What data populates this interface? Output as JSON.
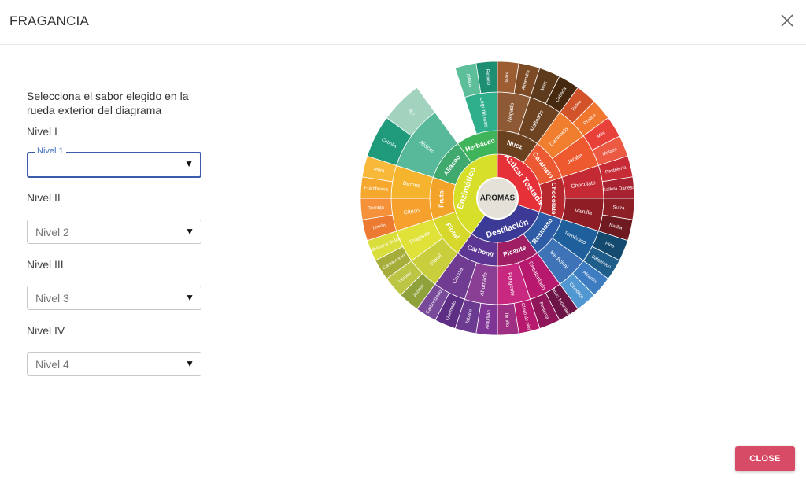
{
  "dialog": {
    "title": "FRAGANCIA",
    "close_label": "CLOSE"
  },
  "form": {
    "instructions": "Selecciona el sabor elegido en la rueda exterior del diagrama",
    "levels": [
      {
        "label": "Nivel I",
        "placeholder": "Nivel 1"
      },
      {
        "label": "Nivel II",
        "placeholder": "Nivel 2"
      },
      {
        "label": "Nivel III",
        "placeholder": "Nivel 3"
      },
      {
        "label": "Nivel IV",
        "placeholder": "Nivel 4"
      }
    ],
    "arrow": "▼"
  },
  "wheel": {
    "center": "AROMAS",
    "level1": [
      {
        "label": "Enzimático",
        "color": "#d8df2a",
        "start": 216,
        "end": 360
      },
      {
        "label": "Azúcar Tostada",
        "color": "#e63138",
        "start": 0,
        "end": 108
      },
      {
        "label": "Destilación",
        "color": "#3b3a96",
        "start": 108,
        "end": 216
      }
    ],
    "level2": [
      {
        "label": "Herbáceo",
        "color": "#40b45a",
        "start": 324,
        "end": 360
      },
      {
        "label": "Nuez",
        "color": "#6b4220",
        "start": 0,
        "end": 36
      },
      {
        "label": "Caramelo",
        "color": "#ec5a33",
        "start": 36,
        "end": 72
      },
      {
        "label": "Chocolate",
        "color": "#b7282e",
        "start": 72,
        "end": 108
      },
      {
        "label": "Resinoso",
        "color": "#2e5ca6",
        "start": 108,
        "end": 144
      },
      {
        "label": "Picante",
        "color": "#a01e63",
        "start": 144,
        "end": 180
      },
      {
        "label": "Carbonil",
        "color": "#5d3693",
        "start": 180,
        "end": 216
      },
      {
        "label": "Floral",
        "color": "#d6d92b",
        "start": 216,
        "end": 252
      },
      {
        "label": "Frutal",
        "color": "#f4a32a",
        "start": 252,
        "end": 288
      },
      {
        "label": "Aliáceo",
        "color": "#3fa96e",
        "start": 288,
        "end": 324
      }
    ],
    "level3": [
      {
        "label": "Leguminoso",
        "color": "#2fae8c",
        "start": 342,
        "end": 360
      },
      {
        "label": "Nogado",
        "color": "#8d5a35",
        "start": 0,
        "end": 18
      },
      {
        "label": "Malteado",
        "color": "#6e4322",
        "start": 18,
        "end": 36
      },
      {
        "label": "Caramelo",
        "color": "#f07e2e",
        "start": 36,
        "end": 54
      },
      {
        "label": "Jarabe",
        "color": "#ee5a30",
        "start": 54,
        "end": 72
      },
      {
        "label": "Chocolate",
        "color": "#c32a33",
        "start": 72,
        "end": 90
      },
      {
        "label": "Vainilla",
        "color": "#8e1d25",
        "start": 90,
        "end": 108
      },
      {
        "label": "Terpénico",
        "color": "#1f5f9b",
        "start": 108,
        "end": 126
      },
      {
        "label": "Medicinal",
        "color": "#3e73b8",
        "start": 126,
        "end": 144
      },
      {
        "label": "Recalentado",
        "color": "#b6196d",
        "start": 144,
        "end": 162
      },
      {
        "label": "Pungente",
        "color": "#c8287f",
        "start": 162,
        "end": 180
      },
      {
        "label": "Ahumado",
        "color": "#8b3f94",
        "start": 180,
        "end": 198
      },
      {
        "label": "Ceniza",
        "color": "#6f3c91",
        "start": 198,
        "end": 216
      },
      {
        "label": "Floral",
        "color": "#c9cf3c",
        "start": 216,
        "end": 234
      },
      {
        "label": "Fragante",
        "color": "#e0e23a",
        "start": 234,
        "end": 252
      },
      {
        "label": "Cítrico",
        "color": "#f6a12e",
        "start": 252,
        "end": 270
      },
      {
        "label": "Berries",
        "color": "#f6b42e",
        "start": 270,
        "end": 288
      },
      {
        "label": "Aliáceo",
        "color": "#57b99a",
        "start": 288,
        "end": 324
      }
    ],
    "level4": [
      {
        "label": "Alfalfa",
        "color": "#5cbf9a",
        "start": 342,
        "end": 351
      },
      {
        "label": "Repollo",
        "color": "#1d8e72",
        "start": 351,
        "end": 360
      },
      {
        "label": "Maní",
        "color": "#9b5d31",
        "start": 0,
        "end": 9
      },
      {
        "label": "Almendra",
        "color": "#7c4a24",
        "start": 9,
        "end": 18
      },
      {
        "label": "Maíz",
        "color": "#5e3a1c",
        "start": 18,
        "end": 27
      },
      {
        "label": "Cebada",
        "color": "#47290f",
        "start": 27,
        "end": 36
      },
      {
        "label": "Toffee",
        "color": "#d2522a",
        "start": 36,
        "end": 45
      },
      {
        "label": "Praline",
        "color": "#f2772e",
        "start": 45,
        "end": 54
      },
      {
        "label": "Miel",
        "color": "#e8413a",
        "start": 54,
        "end": 63
      },
      {
        "label": "Melaza",
        "color": "#ec5a44",
        "start": 63,
        "end": 72
      },
      {
        "label": "Pastelería",
        "color": "#c62b36",
        "start": 72,
        "end": 81
      },
      {
        "label": "Galleta Danesa",
        "color": "#a72230",
        "start": 81,
        "end": 90
      },
      {
        "label": "Suiza",
        "color": "#8d1f26",
        "start": 90,
        "end": 99
      },
      {
        "label": "Natilla",
        "color": "#6f1a21",
        "start": 99,
        "end": 108
      },
      {
        "label": "Pino",
        "color": "#154a6f",
        "start": 108,
        "end": 117
      },
      {
        "label": "Balsámico",
        "color": "#1f5d8a",
        "start": 117,
        "end": 126
      },
      {
        "label": "Alcanfor",
        "color": "#3d7cc0",
        "start": 126,
        "end": 135
      },
      {
        "label": "Cineólico",
        "color": "#5197d1",
        "start": 135,
        "end": 144
      },
      {
        "label": "Nuez Moscada",
        "color": "#6d1446",
        "start": 144,
        "end": 153
      },
      {
        "label": "Pimienta",
        "color": "#8f1658",
        "start": 153,
        "end": 162
      },
      {
        "label": "Clavo de olor",
        "color": "#b6196d",
        "start": 162,
        "end": 171
      },
      {
        "label": "Tomillo",
        "color": "#9e2f82",
        "start": 171,
        "end": 180
      },
      {
        "label": "Alquitrán",
        "color": "#7e3595",
        "start": 180,
        "end": 189
      },
      {
        "label": "Tabaco",
        "color": "#6b3a91",
        "start": 189,
        "end": 198
      },
      {
        "label": "Quemado",
        "color": "#5e2e84",
        "start": 198,
        "end": 207
      },
      {
        "label": "Carbonizado",
        "color": "#7a4a9a",
        "start": 207,
        "end": 216
      },
      {
        "label": "Jazmín",
        "color": "#8ea13a",
        "start": 216,
        "end": 225
      },
      {
        "label": "Verdes",
        "color": "#bcc544",
        "start": 225,
        "end": 234
      },
      {
        "label": "Cardamomo",
        "color": "#a6ad3a",
        "start": 234,
        "end": 243
      },
      {
        "label": "Albahaca Dulce",
        "color": "#dade3c",
        "start": 243,
        "end": 252
      },
      {
        "label": "Limón",
        "color": "#ec7a30",
        "start": 252,
        "end": 261
      },
      {
        "label": "Toronja",
        "color": "#f5913a",
        "start": 261,
        "end": 270
      },
      {
        "label": "Frambuesa",
        "color": "#f6a82e",
        "start": 270,
        "end": 279
      },
      {
        "label": "Mora",
        "color": "#f8b93a",
        "start": 279,
        "end": 288
      },
      {
        "label": "Cebolla",
        "color": "#1f9a7b",
        "start": 288,
        "end": 306
      },
      {
        "label": "Ajo",
        "color": "#a2d3bf",
        "start": 306,
        "end": 324
      }
    ]
  }
}
